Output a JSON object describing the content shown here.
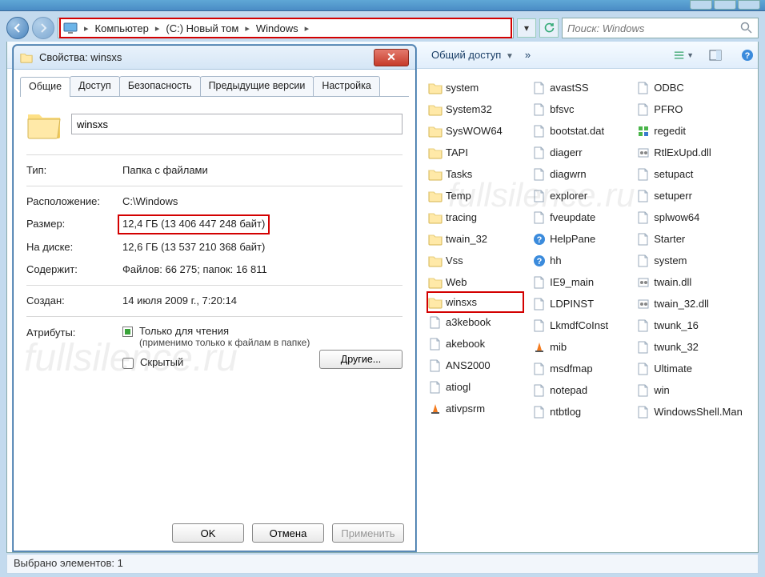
{
  "breadcrumb": {
    "root": "Компьютер",
    "drive": "(C:) Новый том",
    "folder": "Windows"
  },
  "search": {
    "placeholder": "Поиск: Windows"
  },
  "cmdbar": {
    "share": "Общий доступ",
    "chev": "»"
  },
  "properties": {
    "title": "Свойства: winsxs",
    "tabs": {
      "general": "Общие",
      "access": "Доступ",
      "security": "Безопасность",
      "prev": "Предыдущие версии",
      "custom": "Настройка"
    },
    "name": "winsxs",
    "labels": {
      "type": "Тип:",
      "location": "Расположение:",
      "size": "Размер:",
      "ondisk": "На диске:",
      "contains": "Содержит:",
      "created": "Создан:",
      "attrs": "Атрибуты:"
    },
    "type": "Папка с файлами",
    "location": "C:\\Windows",
    "size": "12,4 ГБ (13 406 447 248 байт)",
    "ondisk": "12,6 ГБ (13 537 210 368 байт)",
    "contains": "Файлов: 66 275; папок: 16 811",
    "created": "14 июля 2009 г., 7:20:14",
    "readonly_label": "Только для чтения",
    "readonly_sub": "(применимо только к файлам в папке)",
    "hidden_label": "Скрытый",
    "other_btn": "Другие...",
    "ok": "OK",
    "cancel": "Отмена",
    "apply": "Применить"
  },
  "files": {
    "col1": [
      {
        "n": "system",
        "t": "folder"
      },
      {
        "n": "System32",
        "t": "folder"
      },
      {
        "n": "SysWOW64",
        "t": "folder"
      },
      {
        "n": "TAPI",
        "t": "folder"
      },
      {
        "n": "Tasks",
        "t": "folder"
      },
      {
        "n": "Temp",
        "t": "folder"
      },
      {
        "n": "tracing",
        "t": "folder"
      },
      {
        "n": "twain_32",
        "t": "folder"
      },
      {
        "n": "Vss",
        "t": "folder"
      },
      {
        "n": "Web",
        "t": "folder"
      },
      {
        "n": "winsxs",
        "t": "folder",
        "sel": true
      },
      {
        "n": "a3kebook",
        "t": "file"
      },
      {
        "n": "akebook",
        "t": "file"
      },
      {
        "n": "ANS2000",
        "t": "file"
      },
      {
        "n": "atiogl",
        "t": "file"
      },
      {
        "n": "ativpsrm",
        "t": "vlc"
      }
    ],
    "col2": [
      {
        "n": "avastSS",
        "t": "screen"
      },
      {
        "n": "bfsvc",
        "t": "app"
      },
      {
        "n": "bootstat.dat",
        "t": "file"
      },
      {
        "n": "diagerr",
        "t": "file"
      },
      {
        "n": "diagwrn",
        "t": "file"
      },
      {
        "n": "explorer",
        "t": "explorer"
      },
      {
        "n": "fveupdate",
        "t": "app"
      },
      {
        "n": "HelpPane",
        "t": "help"
      },
      {
        "n": "hh",
        "t": "help"
      },
      {
        "n": "IE9_main",
        "t": "file"
      },
      {
        "n": "LDPINST",
        "t": "file"
      },
      {
        "n": "LkmdfCoInst",
        "t": "file"
      },
      {
        "n": "mib",
        "t": "vlc"
      },
      {
        "n": "msdfmap",
        "t": "ini"
      },
      {
        "n": "notepad",
        "t": "notepad"
      },
      {
        "n": "ntbtlog",
        "t": "file"
      }
    ],
    "col3": [
      {
        "n": "ODBC",
        "t": "file"
      },
      {
        "n": "PFRO",
        "t": "file"
      },
      {
        "n": "regedit",
        "t": "reg"
      },
      {
        "n": "RtlExUpd.dll",
        "t": "dll"
      },
      {
        "n": "setupact",
        "t": "file"
      },
      {
        "n": "setuperr",
        "t": "file"
      },
      {
        "n": "splwow64",
        "t": "app"
      },
      {
        "n": "Starter",
        "t": "file"
      },
      {
        "n": "system",
        "t": "ini"
      },
      {
        "n": "twain.dll",
        "t": "dll"
      },
      {
        "n": "twain_32.dll",
        "t": "dll"
      },
      {
        "n": "twunk_16",
        "t": "app"
      },
      {
        "n": "twunk_32",
        "t": "twunk"
      },
      {
        "n": "Ultimate",
        "t": "file"
      },
      {
        "n": "win",
        "t": "ini"
      },
      {
        "n": "WindowsShell.Man",
        "t": "file"
      }
    ]
  },
  "status": "Выбрано элементов: 1",
  "watermark": "fullsilence.ru"
}
